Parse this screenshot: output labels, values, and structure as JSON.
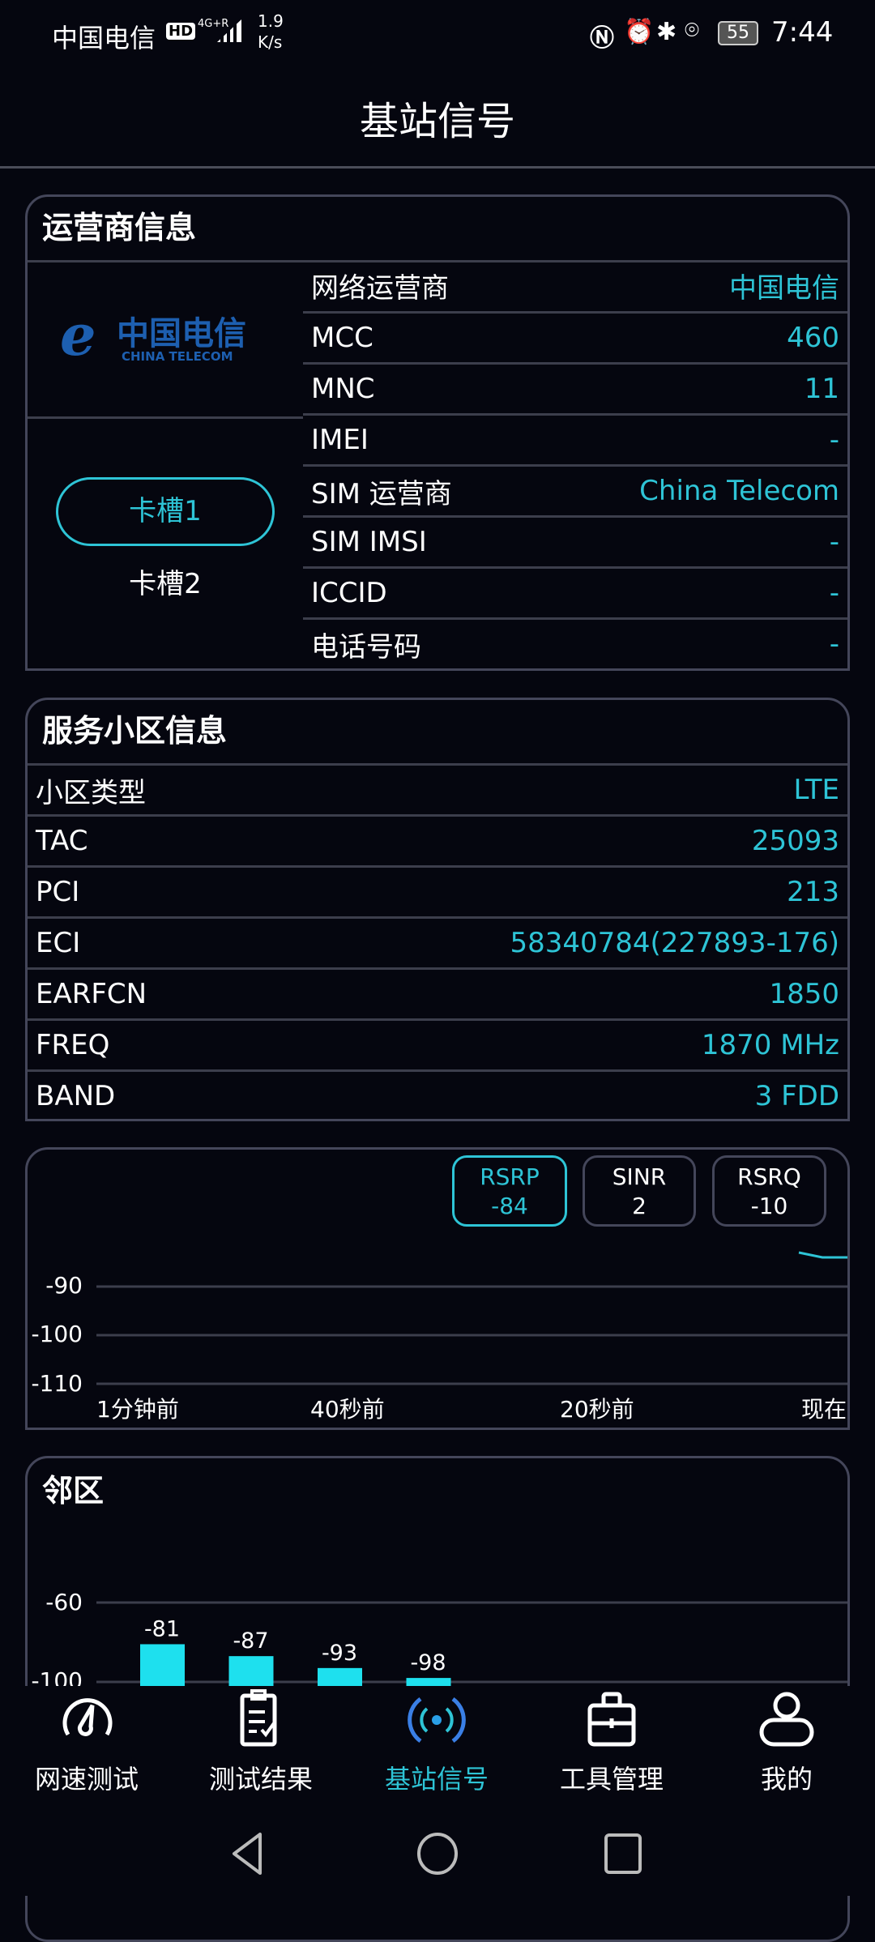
{
  "status_bar": {
    "carrier": "中国电信",
    "hd": "HD",
    "network": "4G+R",
    "speed_value": "1.9",
    "speed_unit": "K/s",
    "battery": "55",
    "time": "7:44",
    "icons": [
      "nfc-icon",
      "alarm-icon",
      "bluetooth-icon",
      "location-icon",
      "battery-icon"
    ]
  },
  "header": {
    "title": "基站信号"
  },
  "operator_card": {
    "title": "运营商信息",
    "logo_text": "中国电信",
    "logo_sub": "CHINA TELECOM",
    "slots": [
      "卡槽1",
      "卡槽2"
    ],
    "selected_slot": 0,
    "rows": [
      {
        "label": "网络运营商",
        "value": "中国电信"
      },
      {
        "label": "MCC",
        "value": "460"
      },
      {
        "label": "MNC",
        "value": "11"
      },
      {
        "label": "IMEI",
        "value": "-"
      },
      {
        "label": "SIM 运营商",
        "value": "China Telecom"
      },
      {
        "label": "SIM IMSI",
        "value": "-"
      },
      {
        "label": "ICCID",
        "value": "-"
      },
      {
        "label": "电话号码",
        "value": "-"
      }
    ]
  },
  "cell_card": {
    "title": "服务小区信息",
    "rows": [
      {
        "label": "小区类型",
        "value": "LTE"
      },
      {
        "label": "TAC",
        "value": "25093"
      },
      {
        "label": "PCI",
        "value": "213"
      },
      {
        "label": "ECI",
        "value": "58340784(227893-176)"
      },
      {
        "label": "EARFCN",
        "value": "1850"
      },
      {
        "label": "FREQ",
        "value": "1870 MHz"
      },
      {
        "label": "BAND",
        "value": "3 FDD"
      }
    ]
  },
  "signal_tabs": [
    {
      "name": "RSRP",
      "value": "-84"
    },
    {
      "name": "SINR",
      "value": "2"
    },
    {
      "name": "RSRQ",
      "value": "-10"
    }
  ],
  "neighbor_card": {
    "title": "邻区"
  },
  "chart_data": [
    {
      "type": "line",
      "series": [
        {
          "values": [
            -83,
            -84,
            -84
          ]
        }
      ],
      "x_ticks": [
        "1分钟前",
        "40秒前",
        "20秒前",
        "现在"
      ],
      "y_ticks": [
        "-90",
        "-100",
        "-110"
      ],
      "ylim": [
        -110,
        -80
      ],
      "grid": true,
      "color": "#2ec4d6"
    },
    {
      "type": "bar",
      "values": [
        -81,
        -87,
        -93,
        -98
      ],
      "labels": [
        "-81",
        "-87",
        "-93",
        "-98"
      ],
      "y_ticks": [
        "-60",
        "-100"
      ],
      "ylim": [
        -100,
        -60
      ],
      "grid": true,
      "color": "#1ee0ee"
    }
  ],
  "bottom_nav": [
    {
      "label": "网速测试",
      "icon": "speedometer-icon"
    },
    {
      "label": "测试结果",
      "icon": "clipboard-check-icon"
    },
    {
      "label": "基站信号",
      "icon": "signal-tower-icon",
      "active": true
    },
    {
      "label": "工具管理",
      "icon": "toolbox-icon"
    },
    {
      "label": "我的",
      "icon": "user-icon"
    }
  ],
  "accent": "#2ec4d6"
}
